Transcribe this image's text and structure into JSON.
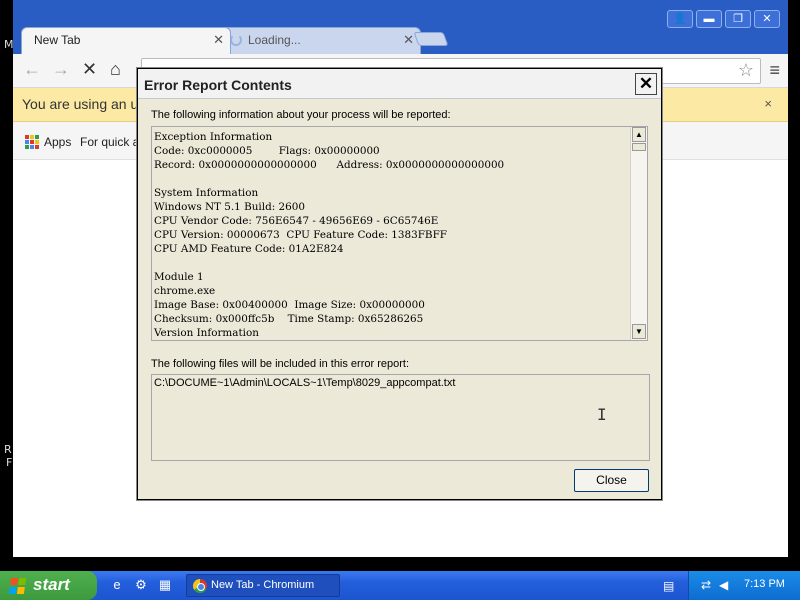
{
  "desktop": {
    "glyph_m": "M",
    "glyph_r": "R",
    "glyph_f": "F"
  },
  "browser": {
    "tabs": [
      {
        "label": "New Tab"
      },
      {
        "label": "Loading..."
      }
    ],
    "window_buttons": {
      "user": "👤",
      "minimize": "▬",
      "maximize": "❐",
      "close": "✕"
    },
    "toolbar": {
      "back": "←",
      "forward": "→",
      "stop": "✕",
      "home": "⌂",
      "star": "☆",
      "menu": "≡"
    },
    "infobar": {
      "text": "You are using an u",
      "close": "×"
    },
    "bookmarks": {
      "apps": "Apps",
      "quick": "For quick ac"
    },
    "colors": {
      "titlebar": "#2a5dc4",
      "infobar": "#fbe9a4"
    }
  },
  "dialog": {
    "title": "Error Report Contents",
    "close_glyph": "✕",
    "info_label": "The following information about your process will be reported:",
    "info_text": "Exception Information\nCode: 0xc0000005        Flags: 0x00000000\nRecord: 0x0000000000000000      Address: 0x0000000000000000\n\nSystem Information\nWindows NT 5.1 Build: 2600\nCPU Vendor Code: 756E6547 - 49656E69 - 6C65746E\nCPU Version: 00000673  CPU Feature Code: 1383FBFF\nCPU AMD Feature Code: 01A2E824\n\nModule 1\nchrome.exe\nImage Base: 0x00400000  Image Size: 0x00000000\nChecksum: 0x000ffc5b    Time Stamp: 0x65286265\nVersion Information",
    "scroll_up": "▲",
    "scroll_down": "▼",
    "files_label": "The following files will be included in this error report:",
    "files_text": "C:\\DOCUME~1\\Admin\\LOCALS~1\\Temp\\8029_appcompat.txt",
    "close_button": "Close"
  },
  "taskbar": {
    "start": "start",
    "task_label": "New Tab - Chromium",
    "clock": "7:13 PM",
    "quicklaunch": [
      "e",
      "⚙",
      "▦"
    ],
    "colors": {
      "taskbar": "#245edb",
      "start": "#3c9a3c"
    }
  }
}
